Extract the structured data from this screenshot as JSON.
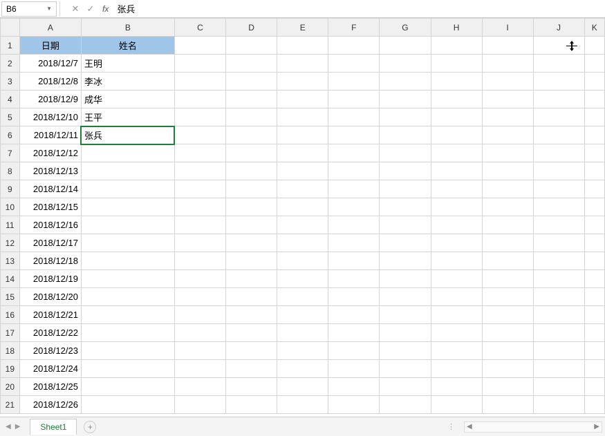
{
  "formula_bar": {
    "name_box": "B6",
    "cancel_glyph": "✕",
    "confirm_glyph": "✓",
    "fx_label": "fx",
    "formula_value": "张兵"
  },
  "columns": [
    "A",
    "B",
    "C",
    "D",
    "E",
    "F",
    "G",
    "H",
    "I",
    "J",
    "K"
  ],
  "row_headers": [
    "1",
    "2",
    "3",
    "4",
    "5",
    "6",
    "7",
    "8",
    "9",
    "10",
    "11",
    "12",
    "13",
    "14",
    "15",
    "16",
    "17",
    "18",
    "19",
    "20",
    "21"
  ],
  "header_row": {
    "date": "日期",
    "name": "姓名"
  },
  "rows": [
    {
      "date": "2018/12/7",
      "name": "王明"
    },
    {
      "date": "2018/12/8",
      "name": "李冰"
    },
    {
      "date": "2018/12/9",
      "name": "成华"
    },
    {
      "date": "2018/12/10",
      "name": "王平"
    },
    {
      "date": "2018/12/11",
      "name": "张兵"
    },
    {
      "date": "2018/12/12",
      "name": ""
    },
    {
      "date": "2018/12/13",
      "name": ""
    },
    {
      "date": "2018/12/14",
      "name": ""
    },
    {
      "date": "2018/12/15",
      "name": ""
    },
    {
      "date": "2018/12/16",
      "name": ""
    },
    {
      "date": "2018/12/17",
      "name": ""
    },
    {
      "date": "2018/12/18",
      "name": ""
    },
    {
      "date": "2018/12/19",
      "name": ""
    },
    {
      "date": "2018/12/20",
      "name": ""
    },
    {
      "date": "2018/12/21",
      "name": ""
    },
    {
      "date": "2018/12/22",
      "name": ""
    },
    {
      "date": "2018/12/23",
      "name": ""
    },
    {
      "date": "2018/12/24",
      "name": ""
    },
    {
      "date": "2018/12/25",
      "name": ""
    },
    {
      "date": "2018/12/26",
      "name": ""
    }
  ],
  "active_cell": "B6",
  "sheet_tabs": {
    "active": "Sheet1",
    "add_glyph": "+"
  }
}
